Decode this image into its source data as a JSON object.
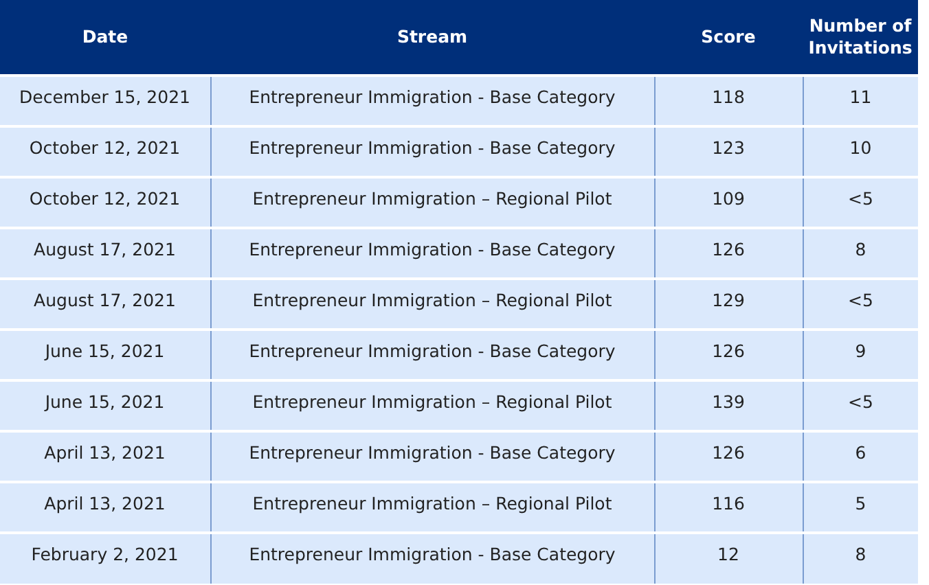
{
  "table": {
    "columns": [
      "Date",
      "Stream",
      "Score",
      "Number of Invitations"
    ],
    "rows": [
      {
        "date": "December 15, 2021",
        "stream": "Entrepreneur Immigration - Base Category",
        "score": "118",
        "invitations": "11"
      },
      {
        "date": "October 12, 2021",
        "stream": "Entrepreneur Immigration - Base Category",
        "score": "123",
        "invitations": "10"
      },
      {
        "date": "October 12, 2021",
        "stream": "Entrepreneur Immigration – Regional Pilot",
        "score": "109",
        "invitations": "<5"
      },
      {
        "date": "August 17, 2021",
        "stream": "Entrepreneur Immigration - Base Category",
        "score": "126",
        "invitations": "8"
      },
      {
        "date": "August 17, 2021",
        "stream": "Entrepreneur Immigration – Regional Pilot",
        "score": "129",
        "invitations": "<5"
      },
      {
        "date": "June 15, 2021",
        "stream": "Entrepreneur Immigration - Base Category",
        "score": "126",
        "invitations": "9"
      },
      {
        "date": "June 15, 2021",
        "stream": "Entrepreneur Immigration – Regional Pilot",
        "score": "139",
        "invitations": "<5"
      },
      {
        "date": "April 13, 2021",
        "stream": "Entrepreneur Immigration - Base Category",
        "score": "126",
        "invitations": "6"
      },
      {
        "date": "April 13, 2021",
        "stream": "Entrepreneur Immigration – Regional Pilot",
        "score": "116",
        "invitations": "5"
      },
      {
        "date": "February 2, 2021",
        "stream": "Entrepreneur Immigration - Base Category",
        "score": "12",
        "invitations": "8"
      }
    ]
  }
}
